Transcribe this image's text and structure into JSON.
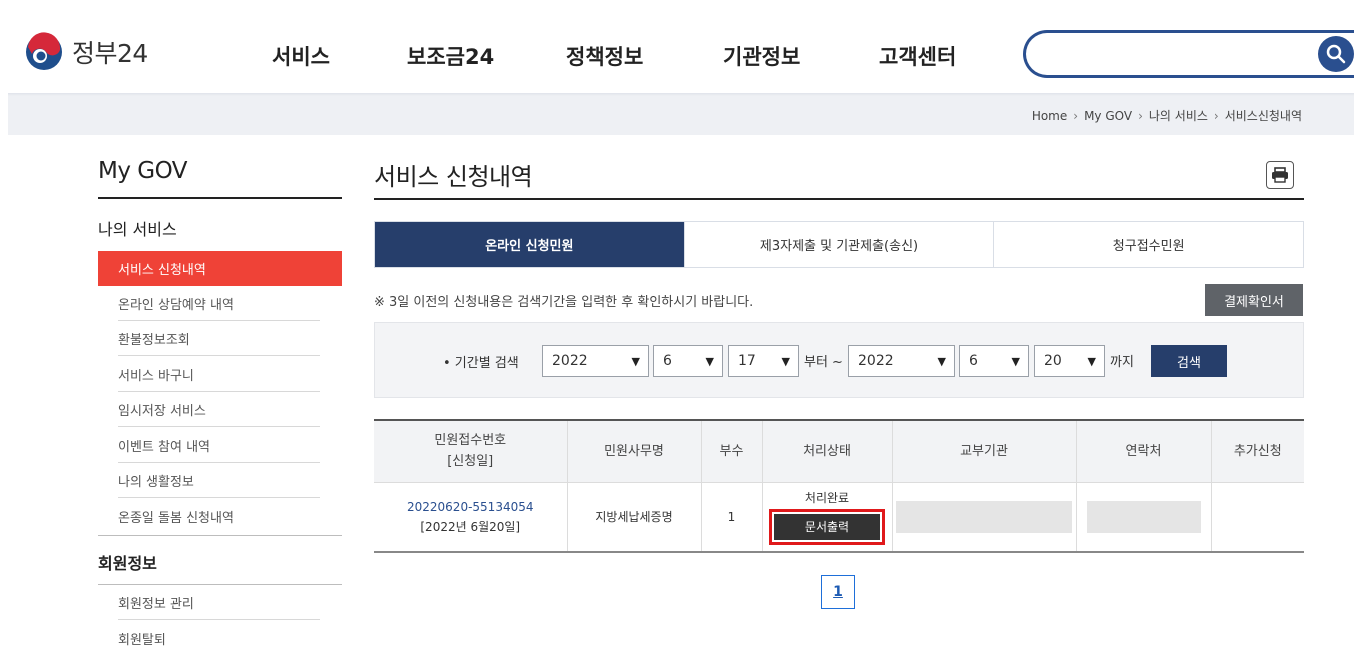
{
  "header": {
    "logo_text": "정부24",
    "nav": [
      "서비스",
      "보조금24",
      "정책정보",
      "기관정보",
      "고객센터"
    ],
    "search_placeholder": ""
  },
  "breadcrumb": [
    "Home",
    "My GOV",
    "나의 서비스",
    "서비스신청내역"
  ],
  "sidebar": {
    "title": "My GOV",
    "section1": "나의 서비스",
    "items": [
      "서비스 신청내역",
      "온라인 상담예약 내역",
      "환불정보조회",
      "서비스 바구니",
      "임시저장 서비스",
      "이벤트 참여 내역",
      "나의 생활정보",
      "온종일 돌봄 신청내역"
    ],
    "section2": "회원정보",
    "member_items": [
      "회원정보 관리",
      "회원탈퇴"
    ]
  },
  "main": {
    "title": "서비스 신청내역",
    "tabs": [
      "온라인 신청민원",
      "제3자제출 및 기관제출(송신)",
      "청구접수민원"
    ],
    "notice": "※ 3일 이전의 신청내용은 검색기간을 입력한 후 확인하시기 바랍니다.",
    "pay_button": "결제확인서",
    "search": {
      "label": "• 기간별 검색",
      "from_year": "2022",
      "from_month": "6",
      "from_day": "17",
      "from_text": "부터 ~",
      "to_year": "2022",
      "to_month": "6",
      "to_day": "20",
      "to_text": "까지",
      "button": "검색"
    },
    "table": {
      "headers": {
        "app_no_line1": "민원접수번호",
        "app_no_line2": "[신청일]",
        "service": "민원사무명",
        "copies": "부수",
        "status": "처리상태",
        "agency": "교부기관",
        "contact": "연락처",
        "extra": "추가신청"
      },
      "rows": [
        {
          "app_no": "20220620-55134054",
          "date": "[2022년 6월20일]",
          "service": "지방세납세증명",
          "copies": "1",
          "status": "처리완료",
          "action": "문서출력"
        }
      ]
    },
    "pagination": [
      "1"
    ]
  },
  "colors": {
    "primary_navy": "#263e6b",
    "accent_red": "#ef4237",
    "highlight_red": "#e0191b"
  }
}
